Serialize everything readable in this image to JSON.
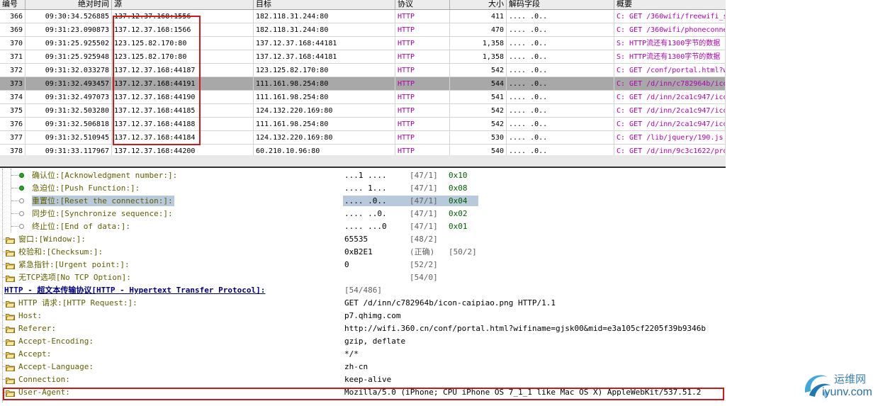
{
  "packet_list": {
    "columns": [
      "编号",
      "绝对时间",
      "源",
      "目标",
      "协议",
      "大小",
      "解码字段",
      "概要"
    ],
    "rows": [
      {
        "no": "366",
        "time": "09:30:34.526885",
        "src": "137.12.37.168:1556",
        "dst": "182.118.31.244:80",
        "proto": "HTTP",
        "size": "411",
        "decode": ".... .0..",
        "summary": "C: GET /360wifi/freewifi_s",
        "selected": false
      },
      {
        "no": "369",
        "time": "09:31:23.090873",
        "src": "137.12.37.168:1566",
        "dst": "182.118.31.244:80",
        "proto": "HTTP",
        "size": "470",
        "decode": ".... .0..",
        "summary": "C: GET /360wifi/phoneconne",
        "selected": false
      },
      {
        "no": "370",
        "time": "09:31:25.925502",
        "src": "123.125.82.170:80",
        "dst": "137.12.37.168:44181",
        "proto": "HTTP",
        "size": "1,358",
        "decode": ".... .0..",
        "summary": "S: HTTP流还有1300字节的数据",
        "selected": false
      },
      {
        "no": "371",
        "time": "09:31:25.925948",
        "src": "123.125.82.170:80",
        "dst": "137.12.37.168:44181",
        "proto": "HTTP",
        "size": "1,358",
        "decode": ".... .0..",
        "summary": "S: HTTP流还有1300字节的数据",
        "selected": false
      },
      {
        "no": "372",
        "time": "09:31:32.033278",
        "src": "137.12.37.168:44187",
        "dst": "123.125.82.170:80",
        "proto": "HTTP",
        "size": "542",
        "decode": ".... .0..",
        "summary": "C: GET /conf/portal.html?w",
        "selected": false
      },
      {
        "no": "373",
        "time": "09:31:32.493457",
        "src": "137.12.37.168:44191",
        "dst": "111.161.98.254:80",
        "proto": "HTTP",
        "size": "544",
        "decode": ".... .0..",
        "summary": "C: GET /d/inn/c782964b/ico",
        "selected": true
      },
      {
        "no": "374",
        "time": "09:31:32.497073",
        "src": "137.12.37.168:44190",
        "dst": "111.161.98.254:80",
        "proto": "HTTP",
        "size": "541",
        "decode": ".... .0..",
        "summary": "C: GET /d/inn/2ca1c947/ico",
        "selected": false
      },
      {
        "no": "375",
        "time": "09:31:32.503280",
        "src": "137.12.37.168:44185",
        "dst": "124.132.220.169:80",
        "proto": "HTTP",
        "size": "542",
        "decode": ".... .0..",
        "summary": "C: GET /d/inn/2ca1c947/ico",
        "selected": false
      },
      {
        "no": "376",
        "time": "09:31:32.506818",
        "src": "137.12.37.168:44188",
        "dst": "111.161.98.254:80",
        "proto": "HTTP",
        "size": "542",
        "decode": ".... .0..",
        "summary": "C: GET /d/inn/2ca1c947/ico",
        "selected": false
      },
      {
        "no": "377",
        "time": "09:31:32.510945",
        "src": "137.12.37.168:44184",
        "dst": "124.132.220.169:80",
        "proto": "HTTP",
        "size": "530",
        "decode": ".... .0..",
        "summary": "C: GET /lib/jquery/190.js",
        "selected": false
      },
      {
        "no": "378",
        "time": "09:31:33.117967",
        "src": "137.12.37.168:44200",
        "dst": "60.210.10.96:80",
        "proto": "HTTP",
        "size": "540",
        "decode": ".... .0..",
        "summary": "C: GET /d/inn/9c3c1622/pro",
        "selected": false
      }
    ]
  },
  "detail_tree": {
    "flags": [
      {
        "label": "确认位:[Acknowledgment number:]:",
        "value": "...1 ....",
        "pos": "[47/1]",
        "hex": "0x10",
        "dot": "green",
        "selected": false
      },
      {
        "label": "急迫位:[Push Function:]:",
        "value": ".... 1...",
        "pos": "[47/1]",
        "hex": "0x08",
        "dot": "green",
        "selected": false
      },
      {
        "label": "重置位:[Reset the connection:]:",
        "value": ".... .0..",
        "pos": "[47/1]",
        "hex": "0x04",
        "dot": "white",
        "selected": true
      },
      {
        "label": "同步位:[Synchronize sequence:]:",
        "value": ".... ..0.",
        "pos": "[47/1]",
        "hex": "0x02",
        "dot": "white",
        "selected": false
      },
      {
        "label": "终止位:[End of data:]:",
        "value": ".... ...0",
        "pos": "[47/1]",
        "hex": "0x01",
        "dot": "white",
        "selected": false
      }
    ],
    "tcp_fields": [
      {
        "label": "窗口:[Window:]:",
        "value": "65535",
        "pos": "[48/2]",
        "extra": ""
      },
      {
        "label": "校验和:[Checksum:]:",
        "value": "0xB2E1",
        "pos": "(正确)",
        "extra": "[50/2]"
      },
      {
        "label": "紧急指针:[Urgent point:]:",
        "value": "0",
        "pos": "[52/2]",
        "extra": ""
      },
      {
        "label": "无TCP选项[No TCP Option]:",
        "value": "",
        "pos": "[54/0]",
        "extra": ""
      }
    ],
    "http_title": "HTTP - 超文本传输协议[HTTP - Hypertext Transfer Protocol]:",
    "http_pos": "[54/486]",
    "http_fields": [
      {
        "label": "HTTP 请求:[HTTP Request:]:",
        "value": "GET /d/inn/c782964b/icon-caipiao.png HTTP/1.1"
      },
      {
        "label": "Host:",
        "value": "p7.qhimg.com"
      },
      {
        "label": "Referer:",
        "value": "http://wifi.360.cn/conf/portal.html?wifiname=gjsk00&mid=e3a105cf2205f39b9346b"
      },
      {
        "label": "Accept-Encoding:",
        "value": "gzip, deflate"
      },
      {
        "label": "Accept:",
        "value": "*/*"
      },
      {
        "label": "Accept-Language:",
        "value": "zh-cn"
      },
      {
        "label": "Connection:",
        "value": "keep-alive"
      },
      {
        "label": "User-Agent:",
        "value": "Mozilla/5.0 (iPhone; CPU iPhone OS 7_1_1 like Mac OS X) AppleWebKit/537.51.2"
      }
    ]
  },
  "watermark": {
    "cn": "运维网",
    "en": "iyunv.com"
  },
  "colors": {
    "highlight": "#d01818",
    "protocol": "#b000b0",
    "selected_row": "#a8a8a8"
  }
}
